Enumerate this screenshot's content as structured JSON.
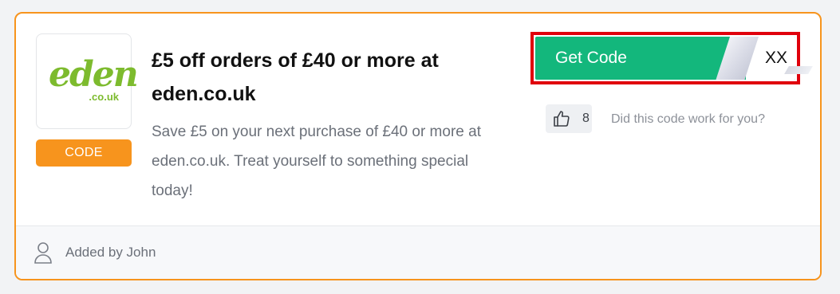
{
  "coupon": {
    "logo": {
      "word": "eden",
      "sub": ".co.uk",
      "brand_color": "#7dbb2e"
    },
    "badge_label": "CODE",
    "title": "£5 off orders of £40 or more at eden.co.uk",
    "description": "Save £5 on your next purchase of £40 or more at eden.co.uk. Treat yourself to something special today!",
    "get_code_label": "Get Code",
    "code_peek": "XX",
    "vote_count": "8",
    "feedback_question": "Did this code work for you?",
    "added_by": "Added by John"
  },
  "icons": {
    "thumb": "thumbs-up-icon",
    "user": "user-icon"
  },
  "colors": {
    "accent": "#f7941d",
    "button": "#13b77c",
    "highlight": "#e0000c"
  }
}
